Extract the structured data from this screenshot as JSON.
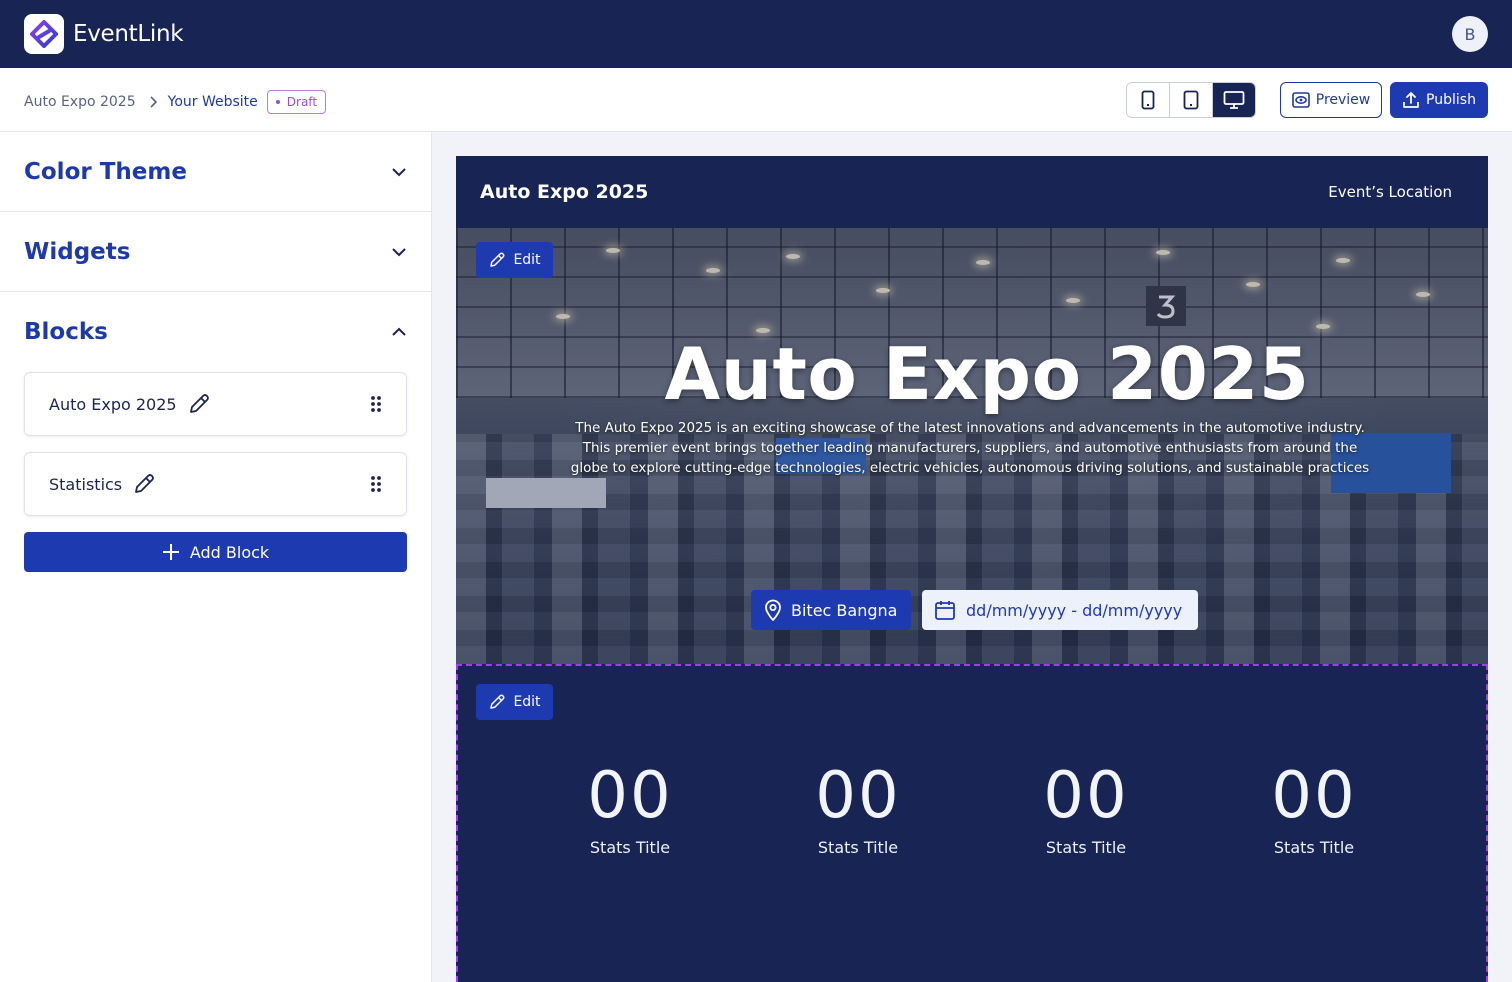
{
  "app": {
    "name": "EventLink",
    "user_initial": "B"
  },
  "breadcrumb": {
    "items": [
      "Auto Expo 2025",
      "Your Website"
    ],
    "status": "Draft"
  },
  "toolbar": {
    "devices": [
      "mobile",
      "tablet",
      "desktop"
    ],
    "active_device": "desktop",
    "preview_label": "Preview",
    "publish_label": "Publish"
  },
  "sidebar": {
    "sections": [
      {
        "title": "Color Theme",
        "expanded": false
      },
      {
        "title": "Widgets",
        "expanded": false
      },
      {
        "title": "Blocks",
        "expanded": true
      }
    ],
    "blocks": [
      {
        "label": "Auto Expo 2025"
      },
      {
        "label": "Statistics"
      }
    ],
    "add_block_label": "Add Block"
  },
  "site": {
    "nav_brand": "Auto Expo 2025",
    "nav_link": "Event’s Location",
    "edit_label": "Edit",
    "hero": {
      "title": "Auto Expo 2025",
      "description": "The Auto Expo 2025 is an exciting showcase of the latest innovations and advancements in the automotive industry. This premier event brings together leading manufacturers, suppliers, and automotive enthusiasts from around the globe to explore cutting-edge technologies, electric vehicles, autonomous driving solutions, and sustainable practices",
      "location": "Bitec Bangna",
      "date_range": "dd/mm/yyyy - dd/mm/yyyy"
    },
    "stats": [
      {
        "value": "00",
        "label": "Stats Title"
      },
      {
        "value": "00",
        "label": "Stats Title"
      },
      {
        "value": "00",
        "label": "Stats Title"
      },
      {
        "value": "00",
        "label": "Stats Title"
      }
    ]
  },
  "colors": {
    "navy": "#172454",
    "primary": "#1e3ab0",
    "draft": "#9a4fe0",
    "selection_border": "#9b40f0"
  }
}
